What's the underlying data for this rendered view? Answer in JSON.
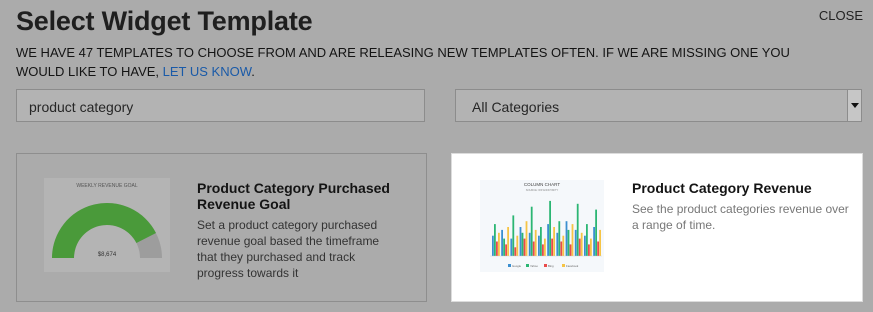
{
  "header": {
    "title": "Select Widget Template",
    "close_label": "CLOSE",
    "description_main": "WE HAVE 47 TEMPLATES TO CHOOSE FROM AND ARE RELEASING NEW TEMPLATES OFTEN. IF WE ARE MISSING ONE YOU WOULD LIKE TO HAVE, ",
    "description_link": "LET US KNOW",
    "description_end": "."
  },
  "filters": {
    "search_value": "product category",
    "category_selected": "All Categories"
  },
  "templates": [
    {
      "title": "Product Category Purchased Revenue Goal",
      "description": "Set a product category purchased revenue goal based the timeframe that they purchased and track progress towards it",
      "thumbnail": {
        "caption": "WEEKLY REVENUE GOAL",
        "value": "$8,674",
        "fill_fraction": 0.85,
        "color": "#4a9a3a"
      }
    },
    {
      "title": "Product Category Revenue",
      "description": "See the product categories revenue over a range of time.",
      "thumbnail": {
        "caption": "COLUMN CHART",
        "subcaption": "SOURCE: WP.ANONYMITY",
        "legend": [
          "Google",
          "Yahoo",
          "Bing",
          "Facebook"
        ],
        "colors": [
          "#3b8fd0",
          "#2bb673",
          "#e94b4b",
          "#f6c445"
        ]
      }
    }
  ]
}
